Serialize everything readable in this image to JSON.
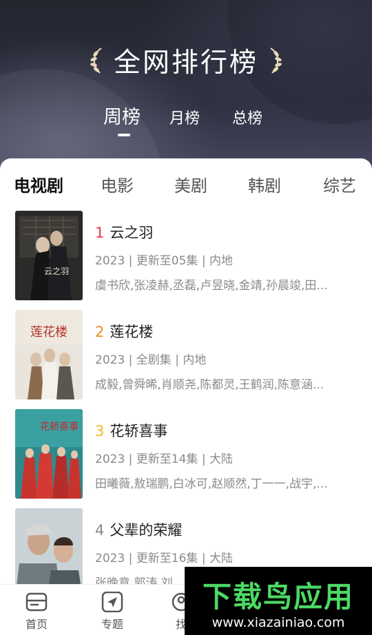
{
  "header": {
    "title": "全网排行榜",
    "period_tabs": [
      {
        "label": "周榜",
        "active": true
      },
      {
        "label": "月榜",
        "active": false
      },
      {
        "label": "总榜",
        "active": false
      }
    ]
  },
  "categories": [
    {
      "label": "电视剧",
      "active": true
    },
    {
      "label": "电影",
      "active": false
    },
    {
      "label": "美剧",
      "active": false
    },
    {
      "label": "韩剧",
      "active": false
    },
    {
      "label": "综艺",
      "active": false
    }
  ],
  "rank_colors": {
    "1": "#e8375a",
    "2": "#f08a24",
    "3": "#f2b720",
    "4": "#888888"
  },
  "items": [
    {
      "rank": "1",
      "title": "云之羽",
      "meta": "2023 | 更新至05集 | 内地",
      "cast": "虞书欣,张凌赫,丞磊,卢昱晓,金靖,孙晨竣,田...",
      "poster_text": "云之羽"
    },
    {
      "rank": "2",
      "title": "莲花楼",
      "meta": "2023 | 全剧集 | 内地",
      "cast": "成毅,曾舜晞,肖顺尧,陈都灵,王鹤润,陈意涵...",
      "poster_text": "莲花楼"
    },
    {
      "rank": "3",
      "title": "花轿喜事",
      "meta": "2023 | 更新至14集 | 大陆",
      "cast": "田曦薇,敖瑞鹏,白冰可,赵顺然,丁一一,战宇,...",
      "poster_text": "花轿喜事"
    },
    {
      "rank": "4",
      "title": "父辈的荣耀",
      "meta": "2023 | 更新至16集 | 大陆",
      "cast": "张晚意,郭涛,刘",
      "poster_text": ""
    }
  ],
  "bottom_nav": [
    {
      "label": "首页",
      "icon": "home-icon"
    },
    {
      "label": "专题",
      "icon": "navigation-icon"
    },
    {
      "label": "找",
      "icon": "find-icon"
    }
  ],
  "watermark": {
    "main": "下载鸟应用",
    "sub": "www.xiazainiao.com"
  }
}
